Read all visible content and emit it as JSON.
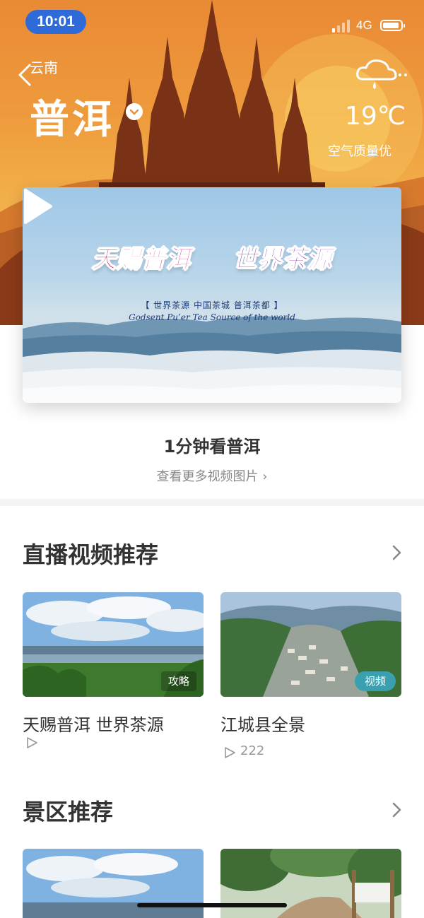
{
  "status_bar": {
    "time": "10:01",
    "network": "4G"
  },
  "header": {
    "province": "云南",
    "city": "普洱",
    "temperature": "19℃",
    "air_quality": "空气质量优",
    "weather_icon": "cloud-rain-icon",
    "back_icon": "chevron-left-icon",
    "dropdown_icon": "chevron-down-icon"
  },
  "hero_video": {
    "banner_title_part1": "天赐普洱",
    "banner_title_part2": "世界茶源",
    "banner_subtitle": "【 世界茶源    中国茶城   普洱茶都 】",
    "banner_english": "Godsent Pu’er Tea Source of the world",
    "caption": "1分钟看普洱",
    "more_link": "查看更多视频图片 ›"
  },
  "live_section": {
    "title": "直播视频推荐",
    "items": [
      {
        "title": "天赐普洱 世界茶源",
        "badge": "攻略",
        "plays": ""
      },
      {
        "title": "江城县全景",
        "badge": "视频",
        "plays": "222"
      }
    ]
  },
  "scenic_section": {
    "title": "景区推荐"
  },
  "colors": {
    "accent_blue": "#2f6bd8",
    "hero_orange": "#ee9a3c",
    "video_badge": "#3aa0b0"
  }
}
